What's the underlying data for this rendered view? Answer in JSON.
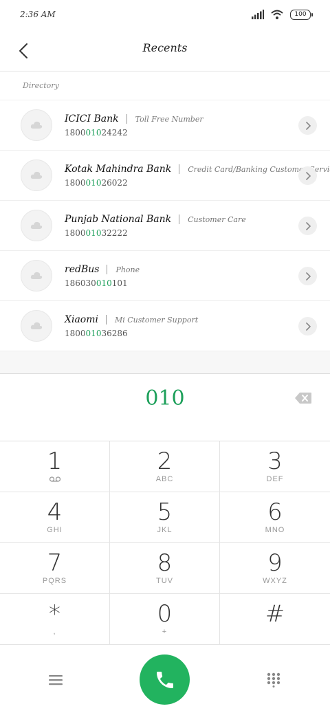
{
  "status": {
    "time": "2:36 AM",
    "battery": "100"
  },
  "header": {
    "title": "Recents"
  },
  "section": {
    "label": "Directory"
  },
  "contacts": [
    {
      "name": "ICICI Bank",
      "desc": "Toll Free Number",
      "num_pre": "1800",
      "num_hl": "010",
      "num_post": "24242"
    },
    {
      "name": "Kotak Mahindra Bank",
      "desc": "Credit Card/Banking Customer Service",
      "num_pre": "1800",
      "num_hl": "010",
      "num_post": "26022"
    },
    {
      "name": "Punjab National Bank",
      "desc": "Customer Care",
      "num_pre": "1800",
      "num_hl": "010",
      "num_post": "32222"
    },
    {
      "name": "redBus",
      "desc": "Phone",
      "num_pre": "186030",
      "num_hl": "010",
      "num_post": "101"
    },
    {
      "name": "Xiaomi",
      "desc": "Mi Customer Support",
      "num_pre": "1800",
      "num_hl": "010",
      "num_post": "36286"
    }
  ],
  "dialer": {
    "input": "010"
  },
  "keys": [
    {
      "digit": "1",
      "letters": ""
    },
    {
      "digit": "2",
      "letters": "ABC"
    },
    {
      "digit": "3",
      "letters": "DEF"
    },
    {
      "digit": "4",
      "letters": "GHI"
    },
    {
      "digit": "5",
      "letters": "JKL"
    },
    {
      "digit": "6",
      "letters": "MNO"
    },
    {
      "digit": "7",
      "letters": "PQRS"
    },
    {
      "digit": "8",
      "letters": "TUV"
    },
    {
      "digit": "9",
      "letters": "WXYZ"
    },
    {
      "digit": "*",
      "letters": ","
    },
    {
      "digit": "0",
      "letters": "+"
    },
    {
      "digit": "#",
      "letters": ""
    }
  ],
  "colors": {
    "accent": "#1ea05b",
    "call_button": "#22b35f"
  },
  "icons": {
    "back": "back-arrow-icon",
    "cloud": "cloud-icon",
    "chevron": "chevron-right-icon",
    "backspace": "backspace-icon",
    "voicemail": "voicemail-icon",
    "menu": "menu-icon",
    "call": "phone-icon",
    "keypad": "keypad-icon"
  }
}
